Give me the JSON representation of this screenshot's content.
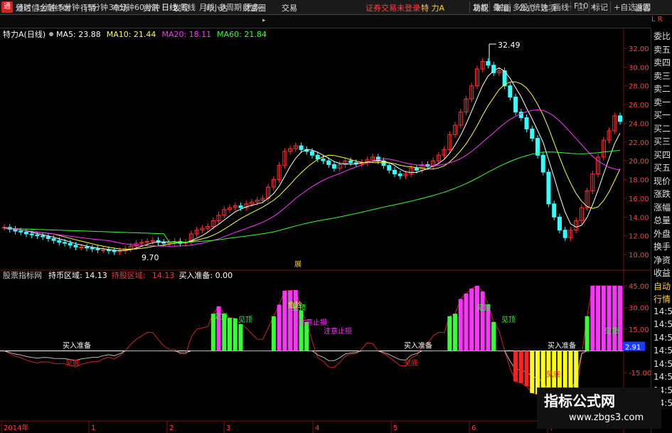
{
  "app": {
    "title": "通达信金融终端",
    "login_warning": "证券交易未登录",
    "stock_name": "特 力A"
  },
  "menu": [
    "行情",
    "市场",
    "资讯",
    "发现",
    "问小达",
    "财富圈",
    "交易"
  ],
  "right_menu": [
    "功能",
    "新面",
    "公式",
    "选项"
  ],
  "guest_label": "游客",
  "window_buttons": [
    "－",
    "□",
    "×"
  ],
  "periods": [
    "分时",
    "1分钟",
    "5分钟",
    "15分钟",
    "30分钟",
    "60分钟",
    "日线",
    "周线",
    "月线",
    "多周期",
    "更多"
  ],
  "active_period": "日线",
  "tools": [
    "复权",
    "叠加",
    "多股",
    "统计",
    "画线",
    "F10",
    "标记",
    "+自选",
    "返回"
  ],
  "corner_label": "L R",
  "main_legend": {
    "name": "特力A(日线)",
    "items": [
      {
        "text": "MA5: 23.88",
        "color": "#ffffff"
      },
      {
        "text": "MA10: 21.44",
        "color": "#ffff33"
      },
      {
        "text": "MA20: 18.11",
        "color": "#ff33ff"
      },
      {
        "text": "MA60: 21.84",
        "color": "#33ff33"
      }
    ]
  },
  "sub_legend": {
    "name": "股票指标网",
    "items": [
      {
        "text": "持币区域: 14.13",
        "color": "#ffffff"
      },
      {
        "text": "持股区域: ",
        "color": "#ff3333"
      },
      {
        "text": "14.13",
        "color": "#ff3333"
      },
      {
        "text": "买入准备: 0.00",
        "color": "#ffffff"
      }
    ]
  },
  "right_labels": [
    "委比",
    "卖五",
    "卖四",
    "卖三",
    "卖二",
    "卖一",
    "买一",
    "买二",
    "买三",
    "买四",
    "买五",
    "现价",
    "涨跌",
    "涨幅",
    "总量",
    "外盘",
    "换手",
    "净资",
    "收益",
    "自动",
    "行情",
    "14:5",
    "14:5",
    "14:5",
    "14:5",
    "14:5",
    "14:5",
    "14:5",
    "14:5"
  ],
  "price_axis": [
    "32.00",
    "30.00",
    "28.00",
    "26.00",
    "24.00",
    "22.00",
    "20.00",
    "18.00",
    "16.00",
    "14.00",
    "12.00",
    "10.00"
  ],
  "ind_axis": [
    "45.00",
    "30.00",
    "15.00",
    "-15.00",
    "-30.00"
  ],
  "ind_current": "2.91",
  "high_label": "32.49",
  "low_label": "9.70",
  "mid_marker": "展",
  "date_labels": [
    "2014年",
    "1",
    "2",
    "3",
    "4",
    "5",
    "6",
    "7"
  ],
  "signals": {
    "buy_ready": "买入准备",
    "bottom": "见底",
    "top": "见顶",
    "high": "危险",
    "stop": "注意止损"
  },
  "watermark": {
    "line1": "指标公式网",
    "line2": "www.zbgs3.com"
  },
  "colors": {
    "up": "#ff3333",
    "down": "#33ffff",
    "ma5": "#ffffff",
    "ma10": "#ffff33",
    "ma20": "#ff33ff",
    "ma60": "#33ff33"
  },
  "chart_data": {
    "type": "candlestick",
    "title": "特力A(日线)",
    "ylim": [
      9,
      33
    ],
    "closes": [
      12.9,
      12.7,
      12.5,
      12.4,
      12.2,
      12.1,
      12.0,
      11.9,
      11.7,
      11.5,
      11.3,
      11.2,
      11.0,
      10.8,
      10.8,
      10.7,
      10.6,
      10.5,
      10.5,
      10.4,
      10.3,
      10.4,
      10.6,
      10.9,
      11.2,
      11.3,
      11.4,
      11.5,
      11.3,
      11.2,
      11.3,
      11.4,
      11.2,
      11.3,
      12.2,
      12.6,
      12.8,
      13.0,
      13.6,
      14.2,
      14.8,
      15.0,
      15.2,
      15.0,
      15.4,
      15.6,
      15.8,
      16.0,
      17.2,
      18.0,
      19.5,
      21.0,
      21.3,
      21.6,
      21.2,
      21.0,
      20.6,
      20.2,
      20.0,
      19.6,
      19.2,
      19.6,
      20.0,
      19.8,
      19.7,
      19.8,
      20.1,
      20.4,
      20.0,
      19.5,
      19.0,
      18.6,
      18.4,
      18.6,
      19.2,
      19.0,
      19.6,
      19.4,
      20.0,
      20.6,
      21.2,
      22.8,
      23.8,
      25.2,
      26.6,
      28.0,
      29.8,
      30.6,
      30.2,
      29.4,
      29.6,
      28.0,
      26.8,
      25.2,
      24.6,
      23.4,
      22.4,
      20.6,
      18.8,
      15.4,
      14.0,
      12.6,
      11.8,
      12.6,
      13.6,
      15.0,
      16.8,
      18.6,
      20.4,
      22.2,
      23.2,
      24.8,
      24.2
    ],
    "ma60_last": 21.84,
    "high": 32.49,
    "low": 9.7
  }
}
